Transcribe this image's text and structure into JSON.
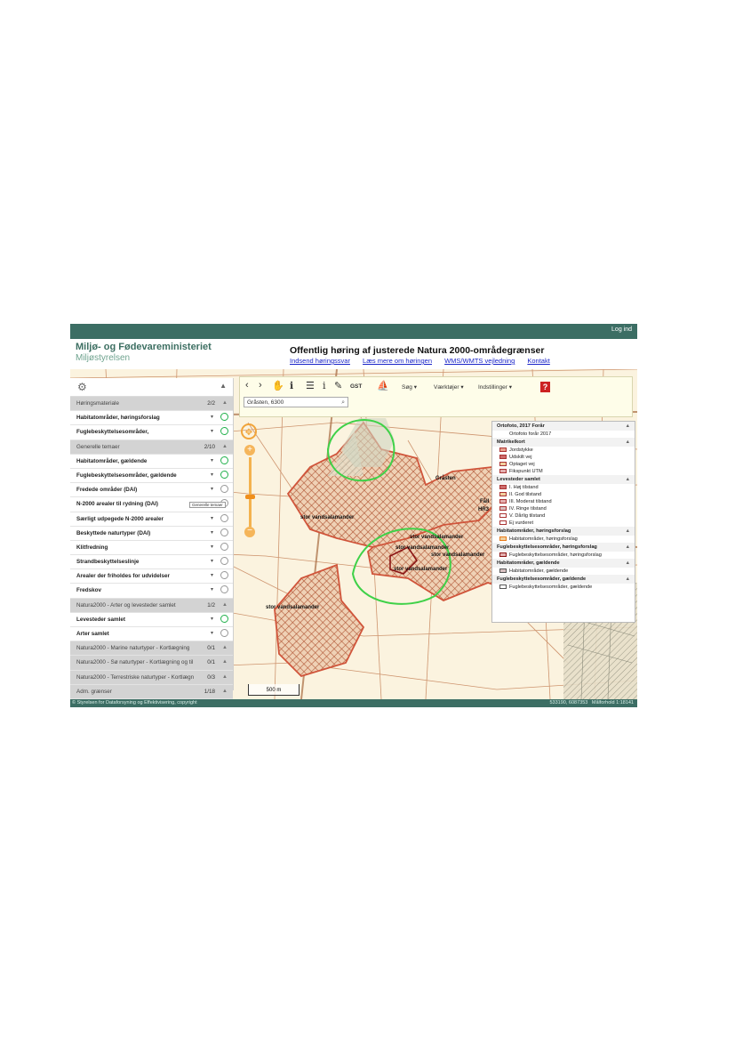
{
  "topbar": {
    "login": "Log ind"
  },
  "header": {
    "brand_line1": "Miljø- og Fødevareministeriet",
    "brand_line2": "Miljøstyrelsen",
    "title": "Offentlig høring af justerede Natura 2000-områdegrænser",
    "links": [
      "Indsend høringssvar",
      "Læs mere om høringen",
      "WMS/WMTS vejledning",
      "Kontakt"
    ]
  },
  "colors": {
    "topbar": "#3c6e64",
    "brand": "#3d6f62",
    "link": "#1a24c8",
    "layer_on": "#23b14d",
    "zoom": "#f1a43a",
    "area": "#c8583a"
  },
  "toolbar": {
    "icons": [
      "chevron-left-icon",
      "chevron-right-icon",
      "hand-icon",
      "info-person-icon",
      "menu-icon",
      "info-icon",
      "eraser-icon"
    ],
    "gst_label": "GST",
    "menus": [
      "Søg",
      "Værktøjer",
      "Indstillinger"
    ],
    "search_value": "Gråsten, 6300"
  },
  "panel": {
    "rows": [
      {
        "kind": "group",
        "label": "Høringsmateriale",
        "count": "2/2"
      },
      {
        "kind": "layer",
        "label": "Habitatområder, høringsforslag",
        "on": true
      },
      {
        "kind": "layer",
        "label": "Fuglebeskyttelsesområder,",
        "on": true
      },
      {
        "kind": "group",
        "label": "Generelle temaer",
        "count": "2/10"
      },
      {
        "kind": "layer",
        "label": "Habitatområder, gældende",
        "on": true
      },
      {
        "kind": "layer",
        "label": "Fuglebeskyttelsesområder, gældende",
        "on": true
      },
      {
        "kind": "layer",
        "label": "Fredede områder (DAI)",
        "on": false
      },
      {
        "kind": "layer",
        "label": "N-2000 arealer til rydning (DAI)",
        "on": false
      },
      {
        "kind": "layer",
        "label": "Særligt udpegede N-2000 arealer",
        "on": false
      },
      {
        "kind": "layer",
        "label": "Beskyttede naturtyper (DAI)",
        "on": false
      },
      {
        "kind": "layer",
        "label": "Klitfredning",
        "on": false
      },
      {
        "kind": "layer",
        "label": "Strandbeskyttelseslinje",
        "on": false
      },
      {
        "kind": "layer",
        "label": "Arealer der friholdes for udvidelser",
        "on": false
      },
      {
        "kind": "layer",
        "label": "Fredskov",
        "on": false
      },
      {
        "kind": "group",
        "label": "Natura2000 - Arter og levesteder samlet",
        "count": "1/2"
      },
      {
        "kind": "layer",
        "label": "Levesteder samlet",
        "on": true
      },
      {
        "kind": "layer",
        "label": "Arter samlet",
        "on": false
      },
      {
        "kind": "group",
        "label": "Natura2000 - Marine naturtyper - Kortlægning",
        "count": "0/1"
      },
      {
        "kind": "group",
        "label": "Natura2000 - Sø naturtyper - Kortlægning og til",
        "count": "0/1"
      },
      {
        "kind": "group",
        "label": "Natura2000 - Terrestriske naturtyper - Kortlægn",
        "count": "0/3"
      },
      {
        "kind": "group",
        "label": "Adm. grænser",
        "count": "1/18"
      }
    ],
    "tooltip": "Generelle temaer"
  },
  "legend": {
    "sections": [
      {
        "title": "Ortofoto, 2017 Forår",
        "items": [
          "Ortofoto forår 2017"
        ]
      },
      {
        "title": "Matrikelkort",
        "items": [
          "Jordstykke",
          "Udskilt vej",
          "Optaget vej",
          "Fikspunkt UTM"
        ]
      },
      {
        "title": "Levesteder samlet",
        "items": [
          "I. Høj tilstand",
          "II. God tilstand",
          "III. Moderat tilstand",
          "IV. Ringe tilstand",
          "V. Dårlig tilstand",
          "Ej vurderet"
        ]
      },
      {
        "title": "Habitatområder, høringsforslag",
        "items": [
          "Habitatområder, høringsforslag"
        ]
      },
      {
        "title": "Fuglebeskyttelsesområder, høringsforslag",
        "items": [
          "Fuglebeskyttelsesområder, høringsforslag"
        ]
      },
      {
        "title": "Habitatområder, gældende",
        "items": [
          "Habitatområder, gældende"
        ]
      },
      {
        "title": "Fuglebeskyttelsesområder, gældende",
        "items": [
          "Fuglebeskyttelsesområder, gældende"
        ]
      }
    ]
  },
  "map": {
    "labels": [
      "Gråsten",
      "stor vandsalamander",
      "stor vandsalamander",
      "stor vandsalamander",
      "stor vandsalamander",
      "stor vandsalamander",
      "stor vandsalamander",
      "Fåll",
      "HR3"
    ],
    "scale": "500 m"
  },
  "footer": {
    "copyright": "© Styrelsen for Dataforsyning og Effektivisering, copyright",
    "coords": "533190, 6087353",
    "scale": "Målforhold 1:18141"
  }
}
